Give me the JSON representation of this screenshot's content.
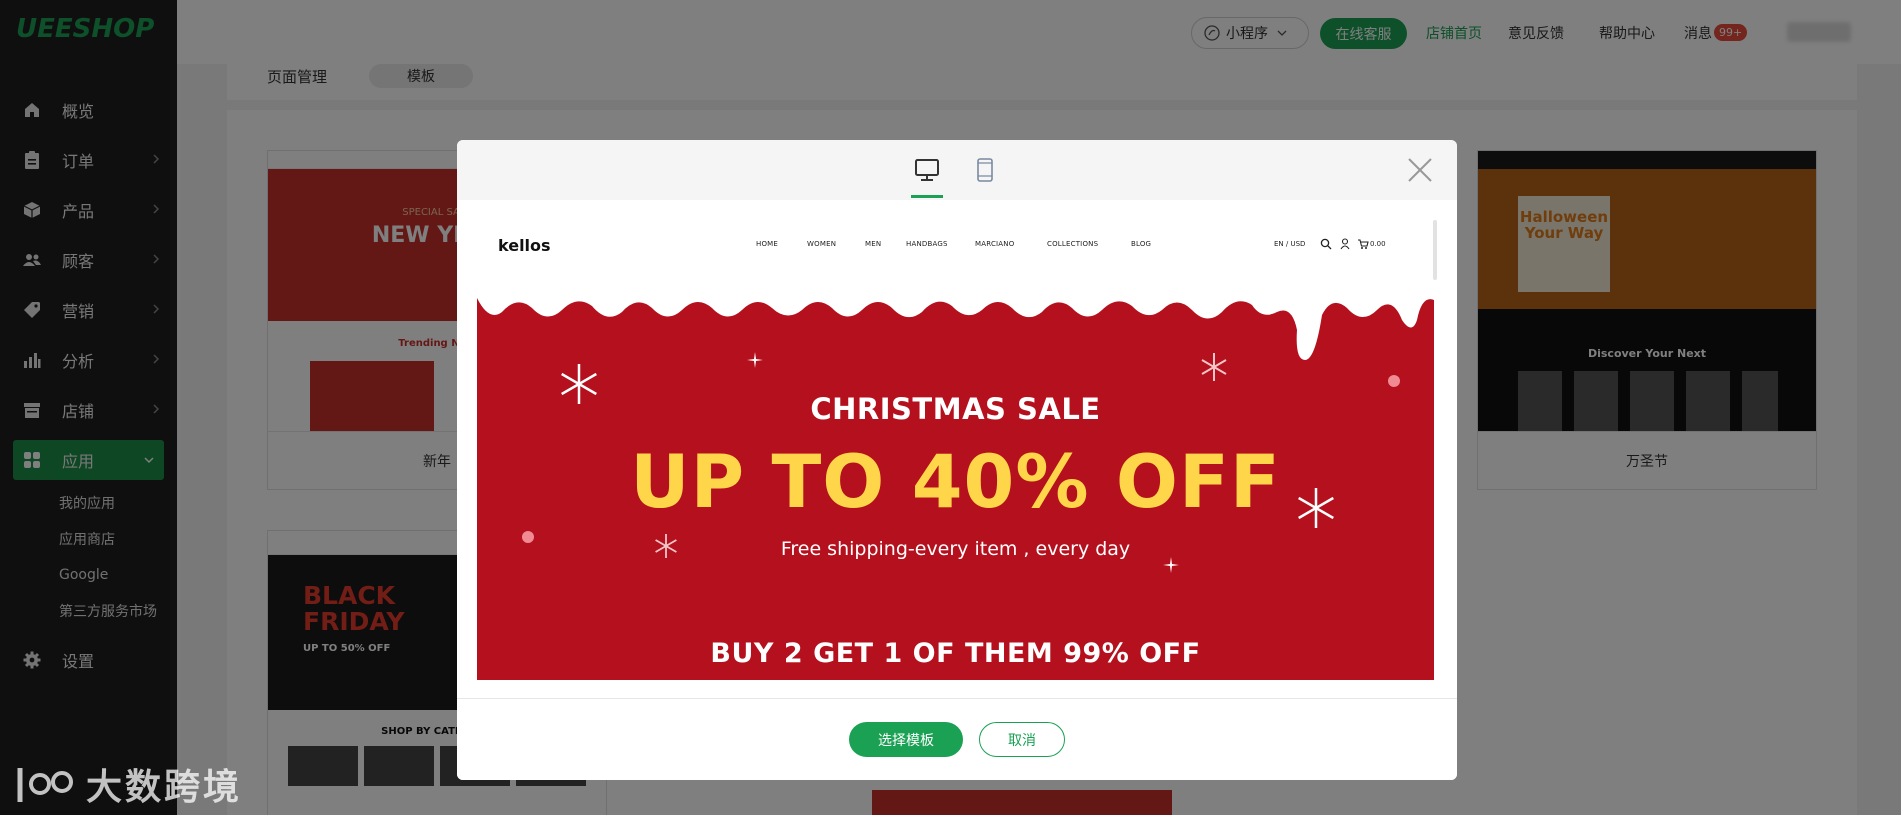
{
  "app": {
    "logo": "UEESHOP",
    "accent": "#1aa154"
  },
  "sidebar": {
    "items": [
      {
        "label": "概览",
        "icon": "home-icon"
      },
      {
        "label": "订单",
        "icon": "clipboard-icon"
      },
      {
        "label": "产品",
        "icon": "box-icon"
      },
      {
        "label": "顾客",
        "icon": "users-icon"
      },
      {
        "label": "营销",
        "icon": "tag-icon"
      },
      {
        "label": "分析",
        "icon": "bar-chart-icon"
      },
      {
        "label": "店铺",
        "icon": "store-icon"
      },
      {
        "label": "应用",
        "icon": "apps-icon"
      }
    ],
    "sub_items": [
      "我的应用",
      "应用商店",
      "Google",
      "第三方服务市场"
    ],
    "settings": "设置"
  },
  "topbar": {
    "mini_program": "小程序",
    "online_service": "在线客服",
    "store_home": "店铺首页",
    "feedback": "意见反馈",
    "help": "帮助中心",
    "messages": "消息",
    "messages_badge": "99+"
  },
  "content": {
    "tab_pages": "页面管理",
    "tab_templates": "模板",
    "cards": [
      {
        "caption": "新年",
        "thumb_title": "NEW YEAR",
        "thumb_kicker": "SPECIAL SALE",
        "thumb_sub": "Trending Now"
      },
      {
        "caption": "万圣节",
        "thumb_title": "Halloween Your Way",
        "thumb_sub": "Discover Your Next"
      },
      {
        "caption": "",
        "thumb_title": "BLACK FRIDAY",
        "thumb_kicker": "UP TO 50% OFF",
        "thumb_sub": "SHOP BY CATEGORY"
      }
    ]
  },
  "modal": {
    "devices": [
      "desktop-icon",
      "mobile-icon"
    ],
    "preview": {
      "site_logo": "kellos",
      "nav": [
        "HOME",
        "WOMEN",
        "MEN",
        "HANDBAGS",
        "MARCIANO",
        "COLLECTIONS",
        "BLOG"
      ],
      "locale": "EN / USD",
      "cart": "0.00",
      "banner_title": "CHRISTMAS SALE",
      "banner_big": "UP TO 40% OFF",
      "banner_sub": "Free shipping-every item , every day",
      "banner_buy": "BUY 2 GET 1 OF THEM 99% OFF"
    },
    "choose_button": "选择模板",
    "cancel_button": "取消"
  },
  "watermark": {
    "logo": "100",
    "text": "大数跨境"
  }
}
